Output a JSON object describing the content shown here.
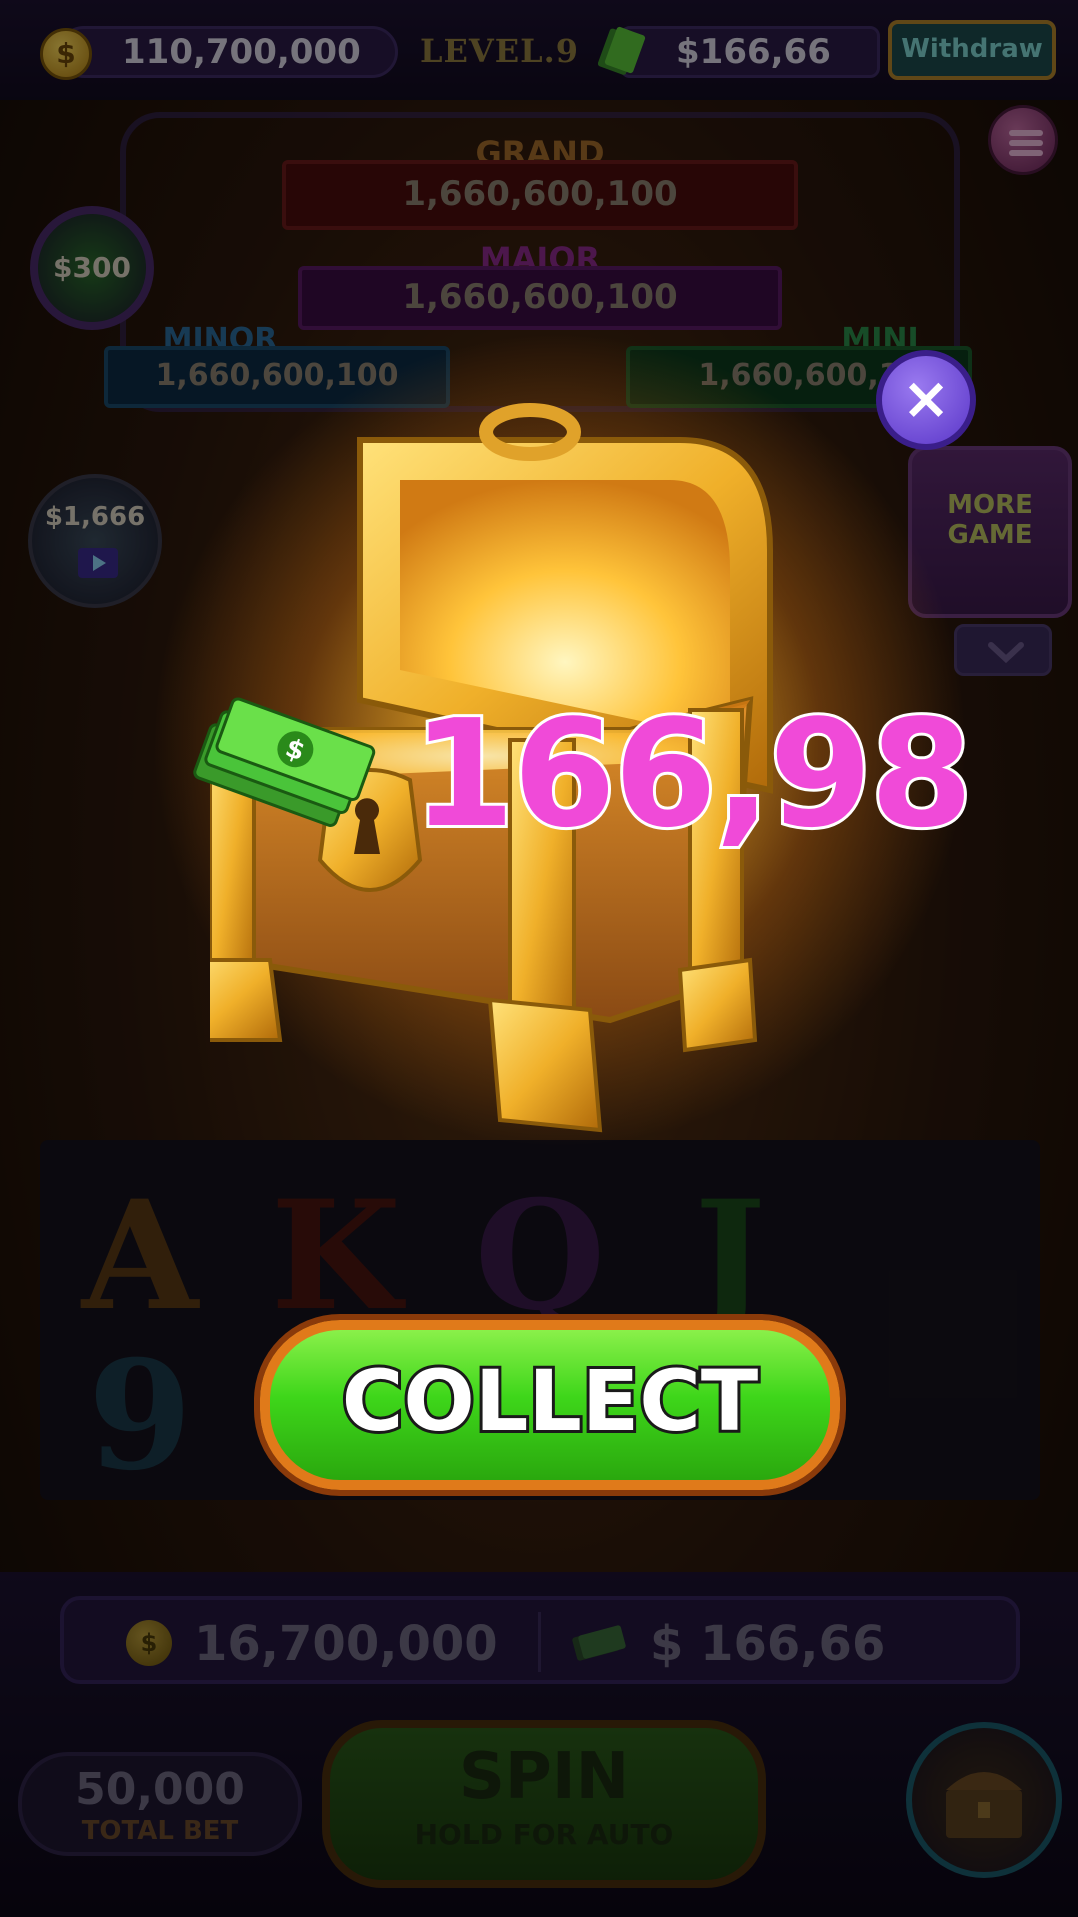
{
  "header": {
    "coin_symbol": "$",
    "coin_balance": "110,700,000",
    "level": "LEVEL.9",
    "cash_balance": "$166,66",
    "withdraw_label": "Withdraw"
  },
  "jackpots": {
    "grand": {
      "label": "GRAND",
      "value": "1,660,600,100"
    },
    "major": {
      "label": "MAJOR",
      "value": "1,660,600,100"
    },
    "minor": {
      "label": "MINOR",
      "value": "1,660,600,100"
    },
    "mini": {
      "label": "MINI",
      "value": "1,660,600,1"
    }
  },
  "side": {
    "bonus_300": "$300",
    "bonus_1666": "$1,666",
    "more_game": "MORE GAME"
  },
  "reels": {
    "symbols": [
      "A",
      "K",
      "Q",
      "J",
      "9"
    ]
  },
  "popup": {
    "reward_amount": "166,98",
    "close_symbol": "×",
    "collect_label": "COLLECT"
  },
  "footer": {
    "coin_symbol": "$",
    "coins": "16,700,000",
    "cash": "$ 166,66",
    "total_bet_value": "50,000",
    "total_bet_label": "TOTAL BET",
    "spin_label": "SPIN",
    "spin_sub": "HOLD FOR AUTO"
  },
  "colors": {
    "reward": "#f04ad8",
    "collect_green": "#3ed61a",
    "close_purple": "#7a56e0"
  }
}
